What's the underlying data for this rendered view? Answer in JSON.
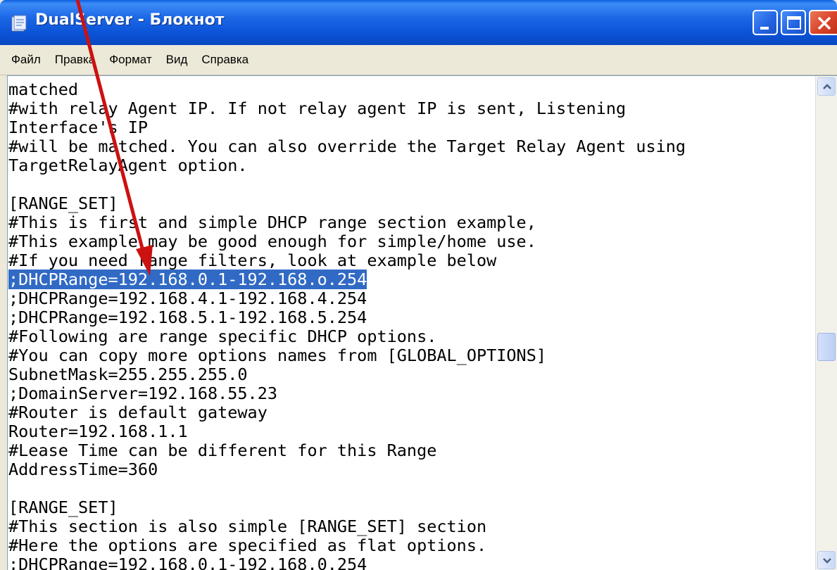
{
  "window": {
    "title": "DualServer - Блокнот"
  },
  "menubar": {
    "items": [
      "Файл",
      "Правка",
      "Формат",
      "Вид",
      "Справка"
    ]
  },
  "editor": {
    "lines": [
      "matched",
      "#with relay Agent IP. If not relay agent IP is sent, Listening",
      "Interface's IP",
      "#will be matched. You can also override the Target Relay Agent using",
      "TargetRelayAgent option.",
      "",
      "[RANGE_SET]",
      "#This is first and simple DHCP range section example,",
      "#This example may be good enough for simple/home use.",
      "#If you need range filters, look at example below",
      ";DHCPRange=192.168.0.1-192.168.o.254",
      ";DHCPRange=192.168.4.1-192.168.4.254",
      ";DHCPRange=192.168.5.1-192.168.5.254",
      "#Following are range specific DHCP options.",
      "#You can copy more options names from [GLOBAL_OPTIONS]",
      "SubnetMask=255.255.255.0",
      ";DomainServer=192.168.55.23",
      "#Router is default gateway",
      "Router=192.168.1.1",
      "#Lease Time can be different for this Range",
      "AddressTime=360",
      "",
      "[RANGE_SET]",
      "#This section is also simple [RANGE_SET] section",
      "#Here the options are specified as flat options.",
      ";DHCPRange=192.168.0.1-192.168.0.254"
    ],
    "selected_line_index": 10
  },
  "icons": {
    "app": "notepad-icon",
    "minimize": "minimize-icon",
    "maximize": "maximize-icon",
    "close": "close-icon",
    "scroll_up": "chevron-up-icon",
    "scroll_down": "chevron-down-icon",
    "annotation": "red-arrow-icon"
  },
  "colors": {
    "selection": "#316ac5",
    "annotation_arrow": "#cc1111",
    "titlebar": "#0a52d6"
  }
}
